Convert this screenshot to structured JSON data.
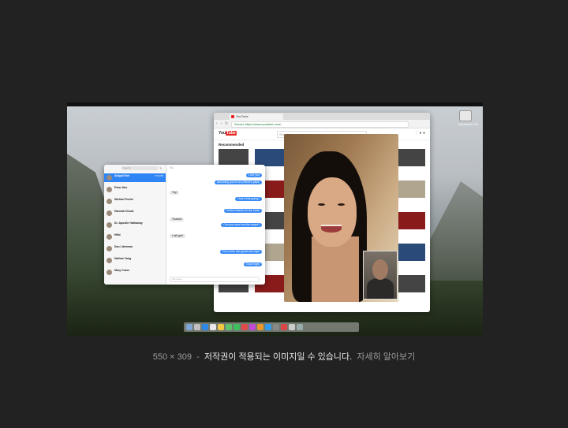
{
  "caption": {
    "size": "550 × 309",
    "separator": "-",
    "notice": "저작권이 적용되는 이미지일 수 있습니다.",
    "more_link": "자세히 알아보기"
  },
  "screenshot": {
    "browser": {
      "tab_title": "YouTube",
      "url": "Secure  https://www.youtube.com/",
      "logo_text": "You",
      "logo_box": "Tube",
      "search_placeholder": "Search",
      "section_title": "Recommended"
    },
    "messages": {
      "search_placeholder": "Search",
      "to_label": "To:",
      "conversations": [
        {
          "name": "Abigail Kim",
          "preview": "",
          "time": "7:32 PM"
        },
        {
          "name": "Peter Kim",
          "preview": "",
          "time": ""
        },
        {
          "name": "Michael Porter",
          "preview": "",
          "time": ""
        },
        {
          "name": "Hannah Chuck",
          "preview": "",
          "time": ""
        },
        {
          "name": "Dr. Apostle Hathaway",
          "preview": "",
          "time": ""
        },
        {
          "name": "Hilbi",
          "preview": "",
          "time": ""
        },
        {
          "name": "Dan Liberman",
          "preview": "",
          "time": ""
        },
        {
          "name": "Nathan Yang",
          "preview": "",
          "time": ""
        },
        {
          "name": "Mary Crane",
          "preview": "",
          "time": ""
        }
      ],
      "bubbles": [
        {
          "dir": "out",
          "text": "Love you"
        },
        {
          "dir": "out",
          "text": "Assuming you're at a friend's place"
        },
        {
          "dir": "in",
          "text": "Yup"
        },
        {
          "dir": "out",
          "text": "How's that going?"
        },
        {
          "dir": "out",
          "text": "Perfect thanks for the invite"
        },
        {
          "dir": "in",
          "text": "Thanks!"
        },
        {
          "dir": "out",
          "text": "Can you send me the recipe?"
        },
        {
          "dir": "in",
          "text": "I will get!"
        },
        {
          "dir": "out",
          "text": "The movie was great last night"
        },
        {
          "dir": "out",
          "text": "Good night"
        }
      ],
      "input_placeholder": "iMessage"
    },
    "desktop_icon_label": "Macintosh HD"
  }
}
